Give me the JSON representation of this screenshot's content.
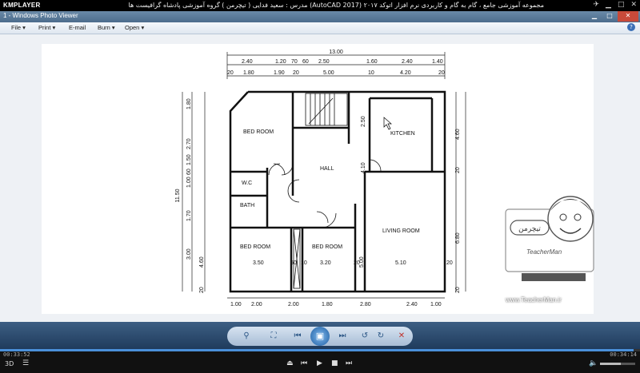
{
  "kmplayer": {
    "logo": "KMPLAYER",
    "title": "مجموعه آموزشی جامع ، گام به گام و کاربردی نرم افزار  اتوکد ۲۰۱۷ (AutoCAD 2017)  مدرس : سعید فدایی ( تیچرمن ) گروه آموزشی پادشاه گرافیست ها",
    "current_time": "00:33:52",
    "total_time": "00:34:14",
    "progress": 0.99,
    "volume": 0.6
  },
  "window": {
    "title": "1 - Windows Photo Viewer",
    "controls": [
      "minimize",
      "maximize",
      "close"
    ]
  },
  "menu": {
    "file": "File",
    "print": "Print",
    "email": "E-mail",
    "burn": "Burn",
    "open": "Open"
  },
  "floorplan": {
    "top_total": "13.00",
    "top_row1": [
      "2.40",
      "1.20",
      "70",
      "60",
      "2.50",
      "1.60",
      "2.40",
      "1.40"
    ],
    "top_row2": [
      "20",
      "1.80",
      "1.90",
      "20",
      "5.00",
      "10",
      "4.20",
      "20"
    ],
    "left_total": "11.50",
    "left_dims": [
      "20",
      "1.80",
      "20",
      "2.70",
      "1.50",
      "60",
      "1.00",
      "60",
      "60",
      "1.70",
      "1.00",
      "60",
      "4.60",
      "3.00",
      "20"
    ],
    "right_dims": [
      "4.60",
      "20",
      "6.80",
      "20"
    ],
    "bottom_dims": [
      "1.00",
      "2.00",
      "2.00",
      "1.80",
      "2.80",
      "2.40",
      "1.00"
    ],
    "rooms": {
      "bed_room_top": "BED ROOM",
      "kitchen": "KITCHEN",
      "hall": "HALL",
      "wc": "W.C",
      "bath": "BATH",
      "bed_room_left": "BED ROOM",
      "bed_room_mid": "BED ROOM",
      "living_room": "LIVING ROOM"
    },
    "inner_dims": {
      "bed_left_width": "3.50",
      "bed_mid_width": "3.20",
      "living_width": "5.10",
      "corridor": "50",
      "corridor2": "10",
      "hall_h": "4.10",
      "kitchen_w": "2.50",
      "living_h": "5.00",
      "w20a": "20",
      "w20b": "20"
    }
  },
  "watermark": {
    "badge": "تیچرمن",
    "brand": "TeacherMan",
    "url": "www.TeacherMan.ir"
  }
}
